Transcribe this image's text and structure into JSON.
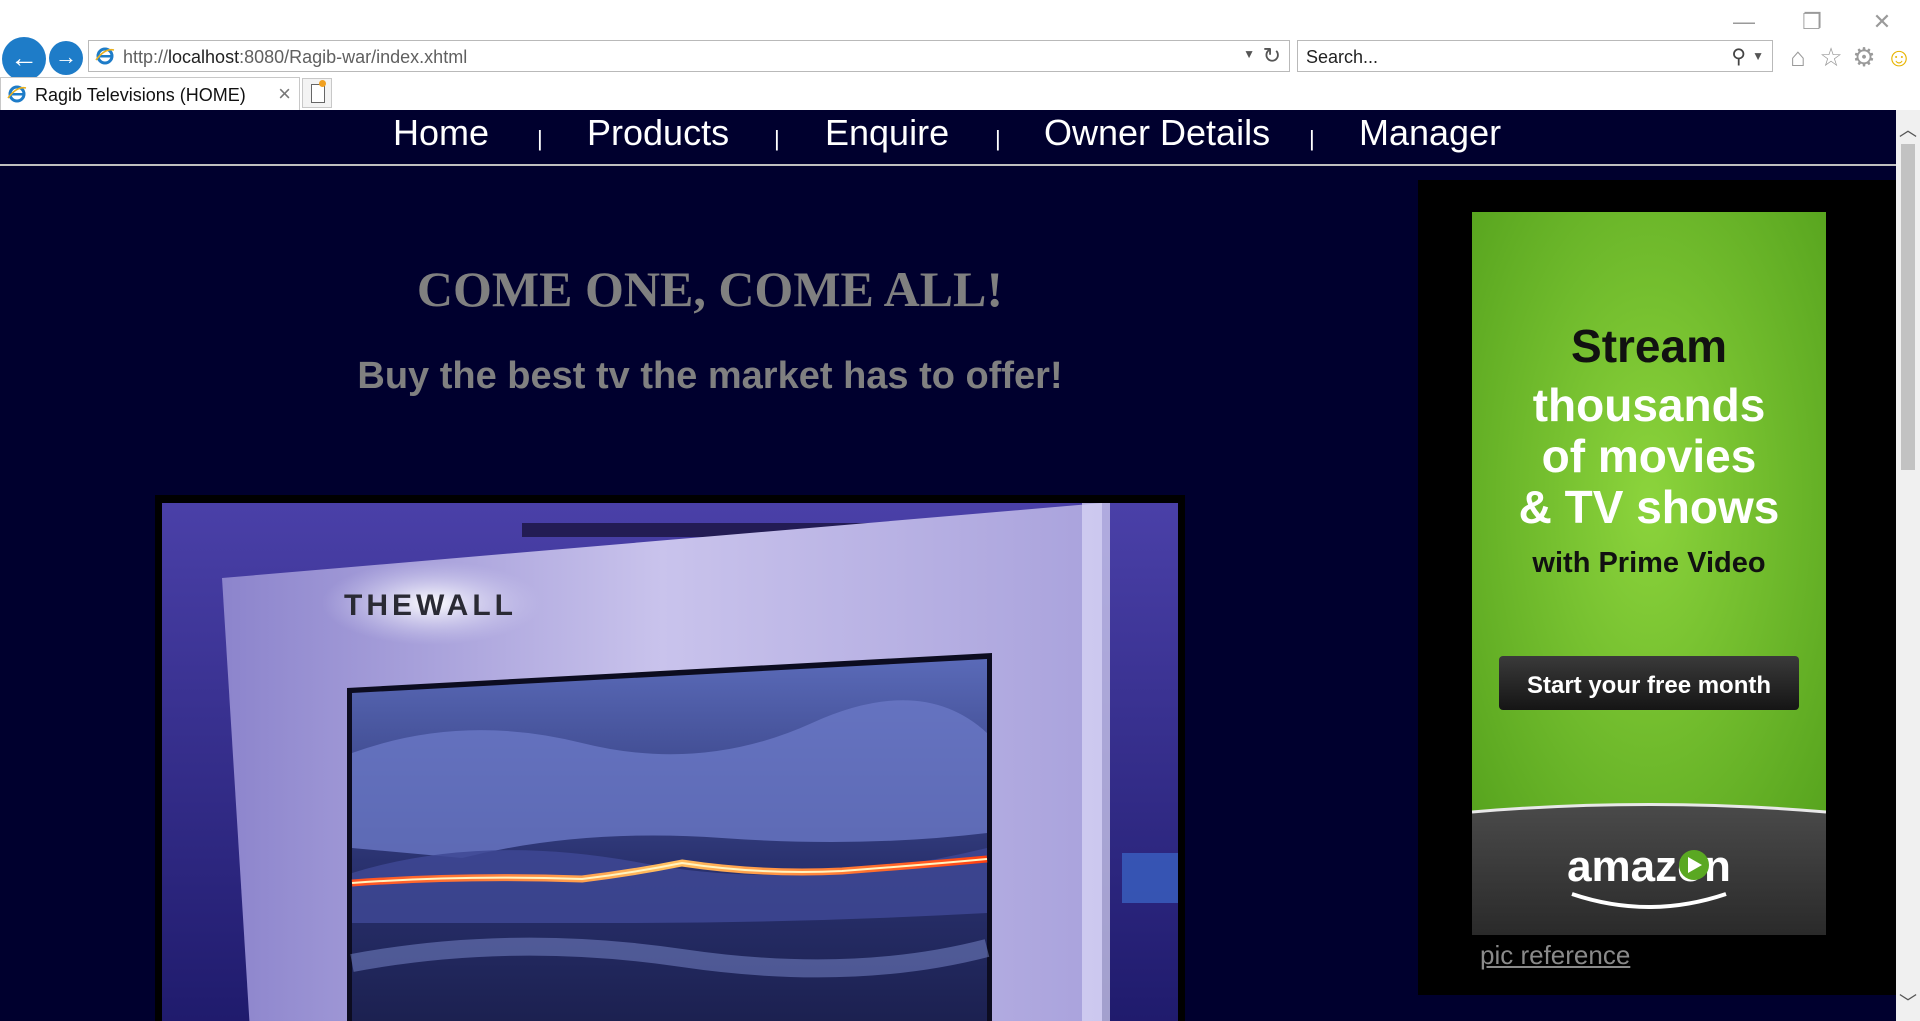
{
  "browser": {
    "url_prefix": "http://",
    "url_host": "localhost",
    "url_rest": ":8080/Ragib-war/index.xhtml",
    "search_placeholder": "Search...",
    "tab_title": "Ragib Televisions (HOME)"
  },
  "nav": {
    "items": [
      "Home",
      "Products",
      "Enquire",
      "Owner Details",
      "Manager"
    ],
    "separator": "|"
  },
  "hero": {
    "headline": "COME ONE, COME ALL!",
    "subline": "Buy the best tv the market has to offer!",
    "tv_brand_text": "THEWALL"
  },
  "ad": {
    "line1": "Stream",
    "line2": "thousands",
    "line3": "of movies",
    "line4": "& TV shows",
    "line5": "with Prime Video",
    "cta": "Start your free month",
    "brand": "amazon",
    "reference_link": "pic reference"
  },
  "colors": {
    "page_bg": "#00002e",
    "text_gray": "#808080",
    "ad_green": "#6ab82a",
    "browser_blue": "#1e7cc8"
  }
}
